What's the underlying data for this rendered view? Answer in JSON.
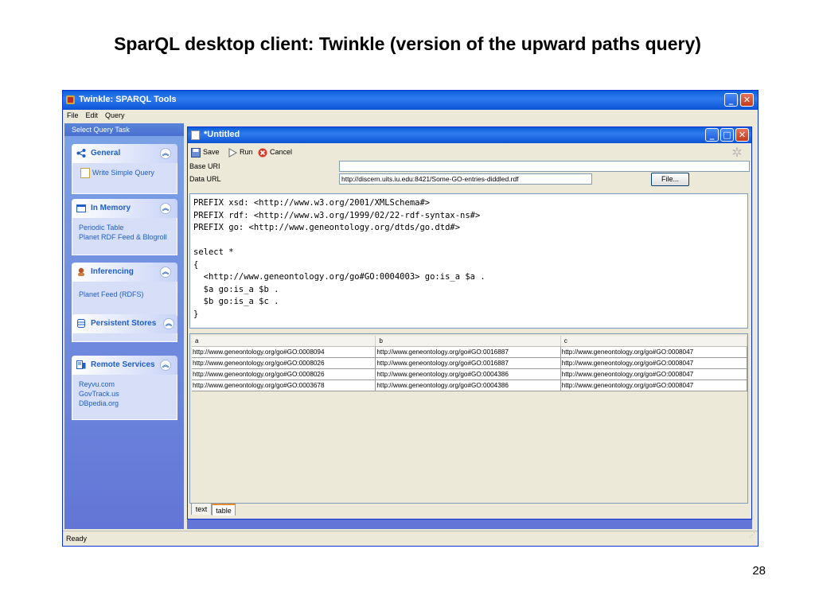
{
  "slide": {
    "title": "SparQL desktop client: Twinkle (version of the upward paths query)",
    "number": "28"
  },
  "app": {
    "title": "Twinkle: SPARQL Tools",
    "icon": "twinkle-logo-icon"
  },
  "menu": {
    "file": "File",
    "edit": "Edit",
    "query": "Query"
  },
  "sidebar": {
    "header": "Select Query Task",
    "general": {
      "title": "General",
      "icon": "share-icon",
      "items": [
        "Write Simple Query"
      ]
    },
    "in_memory": {
      "title": "In Memory",
      "icon": "folder-icon",
      "items": [
        "Periodic Table",
        "Planet RDF Feed & Blogroll"
      ]
    },
    "inferencing": {
      "title": "Inferencing",
      "icon": "gear-person-icon",
      "items": [
        "Planet Feed (RDFS)"
      ]
    },
    "persistent": {
      "title": "Persistent Stores",
      "icon": "database-icon"
    },
    "remote": {
      "title": "Remote Services",
      "icon": "server-icon",
      "items": [
        "Reyvu.com",
        "GovTrack.us",
        "DBpedia.org"
      ]
    }
  },
  "doc": {
    "title": "*Untitled",
    "toolbar": {
      "save": "Save",
      "run": "Run",
      "cancel": "Cancel"
    },
    "base_uri_label": "Base URI",
    "base_uri_value": "",
    "data_url_label": "Data URL",
    "data_url_value": "http://discern.uits.iu.edu:8421/Some-GO-entries-diddled.rdf",
    "file_button": "File...",
    "query_lines": [
      "PREFIX xsd: <http://www.w3.org/2001/XMLSchema#>",
      "PREFIX rdf: <http://www.w3.org/1999/02/22-rdf-syntax-ns#>",
      "PREFIX go: <http://www.geneontology.org/dtds/go.dtd#>",
      "",
      "select *",
      "{",
      "  <http://www.geneontology.org/go#GO:0004003> go:is_a $a .",
      "  $a go:is_a $b .",
      "  $b go:is_a $c .",
      "}"
    ],
    "results": {
      "columns": [
        "a",
        "b",
        "c"
      ],
      "rows": [
        [
          "http://www.geneontology.org/go#GO:0008094",
          "http://www.geneontology.org/go#GO:0016887",
          "http://www.geneontology.org/go#GO:0008047"
        ],
        [
          "http://www.geneontology.org/go#GO:0008026",
          "http://www.geneontology.org/go#GO:0016887",
          "http://www.geneontology.org/go#GO:0008047"
        ],
        [
          "http://www.geneontology.org/go#GO:0008026",
          "http://www.geneontology.org/go#GO:0004386",
          "http://www.geneontology.org/go#GO:0008047"
        ],
        [
          "http://www.geneontology.org/go#GO:0003678",
          "http://www.geneontology.org/go#GO:0004386",
          "http://www.geneontology.org/go#GO:0008047"
        ]
      ]
    },
    "tabs": [
      "text",
      "table"
    ],
    "active_tab": "table"
  },
  "status": "Ready",
  "colors": {
    "xp_blue": "#0a5fd8",
    "sidebar_blue": "#6375d6",
    "link_blue": "#215dc6",
    "tab_orange": "#e68b2c",
    "close_red": "#c33a1f"
  }
}
